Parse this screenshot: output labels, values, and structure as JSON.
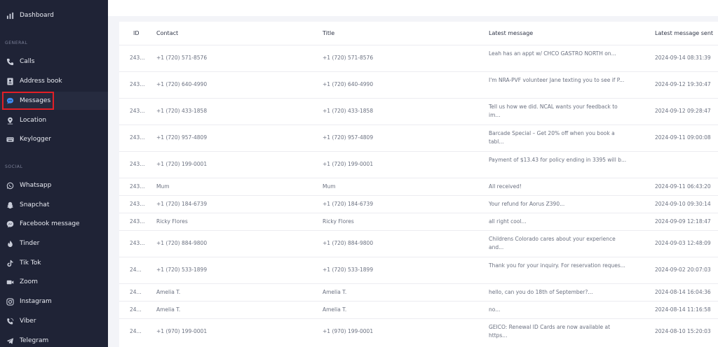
{
  "sidebar": {
    "dashboard_label": "Dashboard",
    "sections": {
      "general": "GENERAL",
      "social": "SOCIAL"
    },
    "items": [
      {
        "label": "Calls",
        "icon": "phone-icon"
      },
      {
        "label": "Address book",
        "icon": "address-book-icon"
      },
      {
        "label": "Messages",
        "icon": "chat-bubble-icon"
      },
      {
        "label": "Location",
        "icon": "location-pin-icon"
      },
      {
        "label": "Keylogger",
        "icon": "keyboard-icon"
      },
      {
        "label": "Whatsapp",
        "icon": "whatsapp-icon"
      },
      {
        "label": "Snapchat",
        "icon": "snapchat-icon"
      },
      {
        "label": "Facebook message",
        "icon": "messenger-icon"
      },
      {
        "label": "Tinder",
        "icon": "tinder-flame-icon"
      },
      {
        "label": "Tik Tok",
        "icon": "tiktok-icon"
      },
      {
        "label": "Zoom",
        "icon": "video-camera-icon"
      },
      {
        "label": "Instagram",
        "icon": "instagram-icon"
      },
      {
        "label": "Viber",
        "icon": "viber-icon"
      },
      {
        "label": "Telegram",
        "icon": "telegram-icon"
      }
    ]
  },
  "table": {
    "columns": [
      "ID",
      "Contact",
      "Title",
      "Latest message",
      "Latest message sent"
    ],
    "rows": [
      {
        "id": "243...",
        "contact": "+1 (720) 571-8576",
        "title": "+1 (720) 571-8576",
        "message": "Leah has an appt w/ CHCO GASTRO NORTH on...",
        "sent": "2024-09-14 08:31:39"
      },
      {
        "id": "243...",
        "contact": "+1 (720) 640-4990",
        "title": "+1 (720) 640-4990",
        "message": "I'm NRA-PVF volunteer Jane texting you to see if P...",
        "sent": "2024-09-12 19:30:47"
      },
      {
        "id": "243...",
        "contact": "+1 (720) 433-1858",
        "title": "+1 (720) 433-1858",
        "message": "Tell us how we did. NCAL wants your feedback to im...",
        "sent": "2024-09-12 09:28:47"
      },
      {
        "id": "243...",
        "contact": "+1 (720) 957-4809",
        "title": "+1 (720) 957-4809",
        "message": "Barcade Special – Get 20% off when you book a tabl...",
        "sent": "2024-09-11 09:00:08"
      },
      {
        "id": "243...",
        "contact": "+1 (720) 199-0001",
        "title": "+1 (720) 199-0001",
        "message": "Payment of $13.43 for policy ending in 3395 will b...",
        "sent": ""
      },
      {
        "id": "243...",
        "contact": "Mum",
        "title": "Mum",
        "message": "All received!",
        "sent": "2024-09-11 06:43:20"
      },
      {
        "id": "243...",
        "contact": "+1 (720) 184-6739",
        "title": "+1 (720) 184-6739",
        "message": "Your refund for Aorus Z390...",
        "sent": "2024-09-10 09:30:14"
      },
      {
        "id": "243...",
        "contact": "Ricky Flores",
        "title": "Ricky Flores",
        "message": "all right cool...",
        "sent": "2024-09-09 12:18:47"
      },
      {
        "id": "243...",
        "contact": "+1 (720) 884-9800",
        "title": "+1 (720) 884-9800",
        "message": "Childrens Colorado cares about your experience and...",
        "sent": "2024-09-03 12:48:09"
      },
      {
        "id": "24...",
        "contact": "+1 (720) 533-1899",
        "title": "+1 (720) 533-1899",
        "message": "Thank you for your inquiry. For reservation reques...",
        "sent": "2024-09-02 20:07:03"
      },
      {
        "id": "24...",
        "contact": "Amelia T.",
        "title": "Amelia T.",
        "message": "hello, can you do 18th of September?...",
        "sent": "2024-08-14 16:04:36"
      },
      {
        "id": "24...",
        "contact": "Amelia T.",
        "title": "Amelia T.",
        "message": "no...",
        "sent": "2024-08-14 11:16:58"
      },
      {
        "id": "24...",
        "contact": "+1 (970) 199-0001",
        "title": "+1 (970) 199-0001",
        "message": "GEICO: Renewal ID Cards are now available at https...",
        "sent": "2024-08-10 15:20:03"
      }
    ]
  }
}
